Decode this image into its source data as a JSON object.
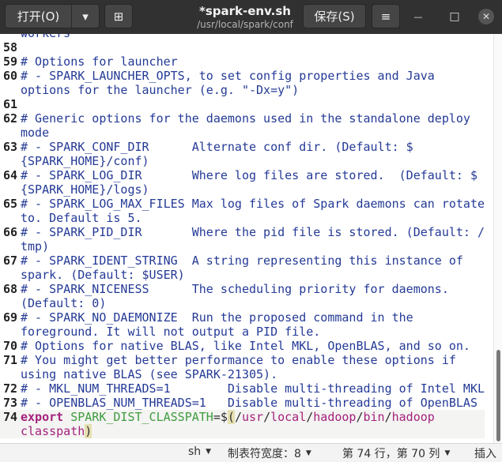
{
  "header": {
    "open_label": "打开(O)",
    "open_arrow": "▾",
    "new_tab_icon": "⊞",
    "title": "*spark-env.sh",
    "subtitle": "/usr/local/spark/conf",
    "save_label": "保存(S)",
    "menu_icon": "≡",
    "minimize_icon": "—",
    "maximize_icon": "□",
    "close_icon": "✕"
  },
  "editor": {
    "lines": [
      {
        "num": "",
        "text": "workers",
        "type": "comment"
      },
      {
        "num": "58",
        "text": "",
        "type": "plain"
      },
      {
        "num": "59",
        "text": "# Options for launcher",
        "type": "comment"
      },
      {
        "num": "60",
        "text": "# - SPARK_LAUNCHER_OPTS, to set config properties and Java",
        "type": "comment"
      },
      {
        "num": "",
        "text": "options for the launcher (e.g. \"-Dx=y\")",
        "type": "comment"
      },
      {
        "num": "61",
        "text": "",
        "type": "plain"
      },
      {
        "num": "62",
        "text": "# Generic options for the daemons used in the standalone deploy",
        "type": "comment"
      },
      {
        "num": "",
        "text": "mode",
        "type": "comment"
      },
      {
        "num": "63",
        "text": "# - SPARK_CONF_DIR      Alternate conf dir. (Default: $",
        "type": "comment"
      },
      {
        "num": "",
        "text": "{SPARK_HOME}/conf)",
        "type": "comment"
      },
      {
        "num": "64",
        "text": "# - SPARK_LOG_DIR       Where log files are stored.  (Default: $",
        "type": "comment"
      },
      {
        "num": "",
        "text": "{SPARK_HOME}/logs)",
        "type": "comment"
      },
      {
        "num": "65",
        "text": "# - SPARK_LOG_MAX_FILES Max log files of Spark daemons can rotate",
        "type": "comment"
      },
      {
        "num": "",
        "text": "to. Default is 5.",
        "type": "comment"
      },
      {
        "num": "66",
        "text": "# - SPARK_PID_DIR       Where the pid file is stored. (Default: /",
        "type": "comment"
      },
      {
        "num": "",
        "text": "tmp)",
        "type": "comment"
      },
      {
        "num": "67",
        "text": "# - SPARK_IDENT_STRING  A string representing this instance of",
        "type": "comment"
      },
      {
        "num": "",
        "text": "spark. (Default: $USER)",
        "type": "comment"
      },
      {
        "num": "68",
        "text": "# - SPARK_NICENESS      The scheduling priority for daemons.",
        "type": "comment"
      },
      {
        "num": "",
        "text": "(Default: 0)",
        "type": "comment"
      },
      {
        "num": "69",
        "text": "# - SPARK_NO_DAEMONIZE  Run the proposed command in the",
        "type": "comment"
      },
      {
        "num": "",
        "text": "foreground. It will not output a PID file.",
        "type": "comment"
      },
      {
        "num": "70",
        "text": "# Options for native BLAS, like Intel MKL, OpenBLAS, and so on.",
        "type": "comment"
      },
      {
        "num": "71",
        "text": "# You might get better performance to enable these options if",
        "type": "comment"
      },
      {
        "num": "",
        "text": "using native BLAS (see SPARK-21305).",
        "type": "comment"
      },
      {
        "num": "72",
        "text": "# - MKL_NUM_THREADS=1        Disable multi-threading of Intel MKL",
        "type": "comment"
      },
      {
        "num": "73",
        "text": "# - OPENBLAS_NUM_THREADS=1   Disable multi-threading of OpenBLAS",
        "type": "comment"
      }
    ],
    "export_line": {
      "num": "74",
      "keyword": "export",
      "space": " ",
      "varname": "SPARK_DIST_CLASSPATH",
      "eq": "=$",
      "open_paren": "(",
      "s1": "/",
      "p1": "usr",
      "s2": "/",
      "p2": "local",
      "s3": "/",
      "p3": "hadoop",
      "s4": "/",
      "p4": "bin",
      "s5": "/",
      "p5": "hadoop"
    },
    "export_cont": {
      "text": "classpath",
      "close_paren": ")"
    }
  },
  "status": {
    "language": "sh",
    "tab_width": "制表符宽度：8",
    "position": "第 74 行，第 70 列",
    "mode": "插入",
    "dropdown_icon": "▼"
  }
}
